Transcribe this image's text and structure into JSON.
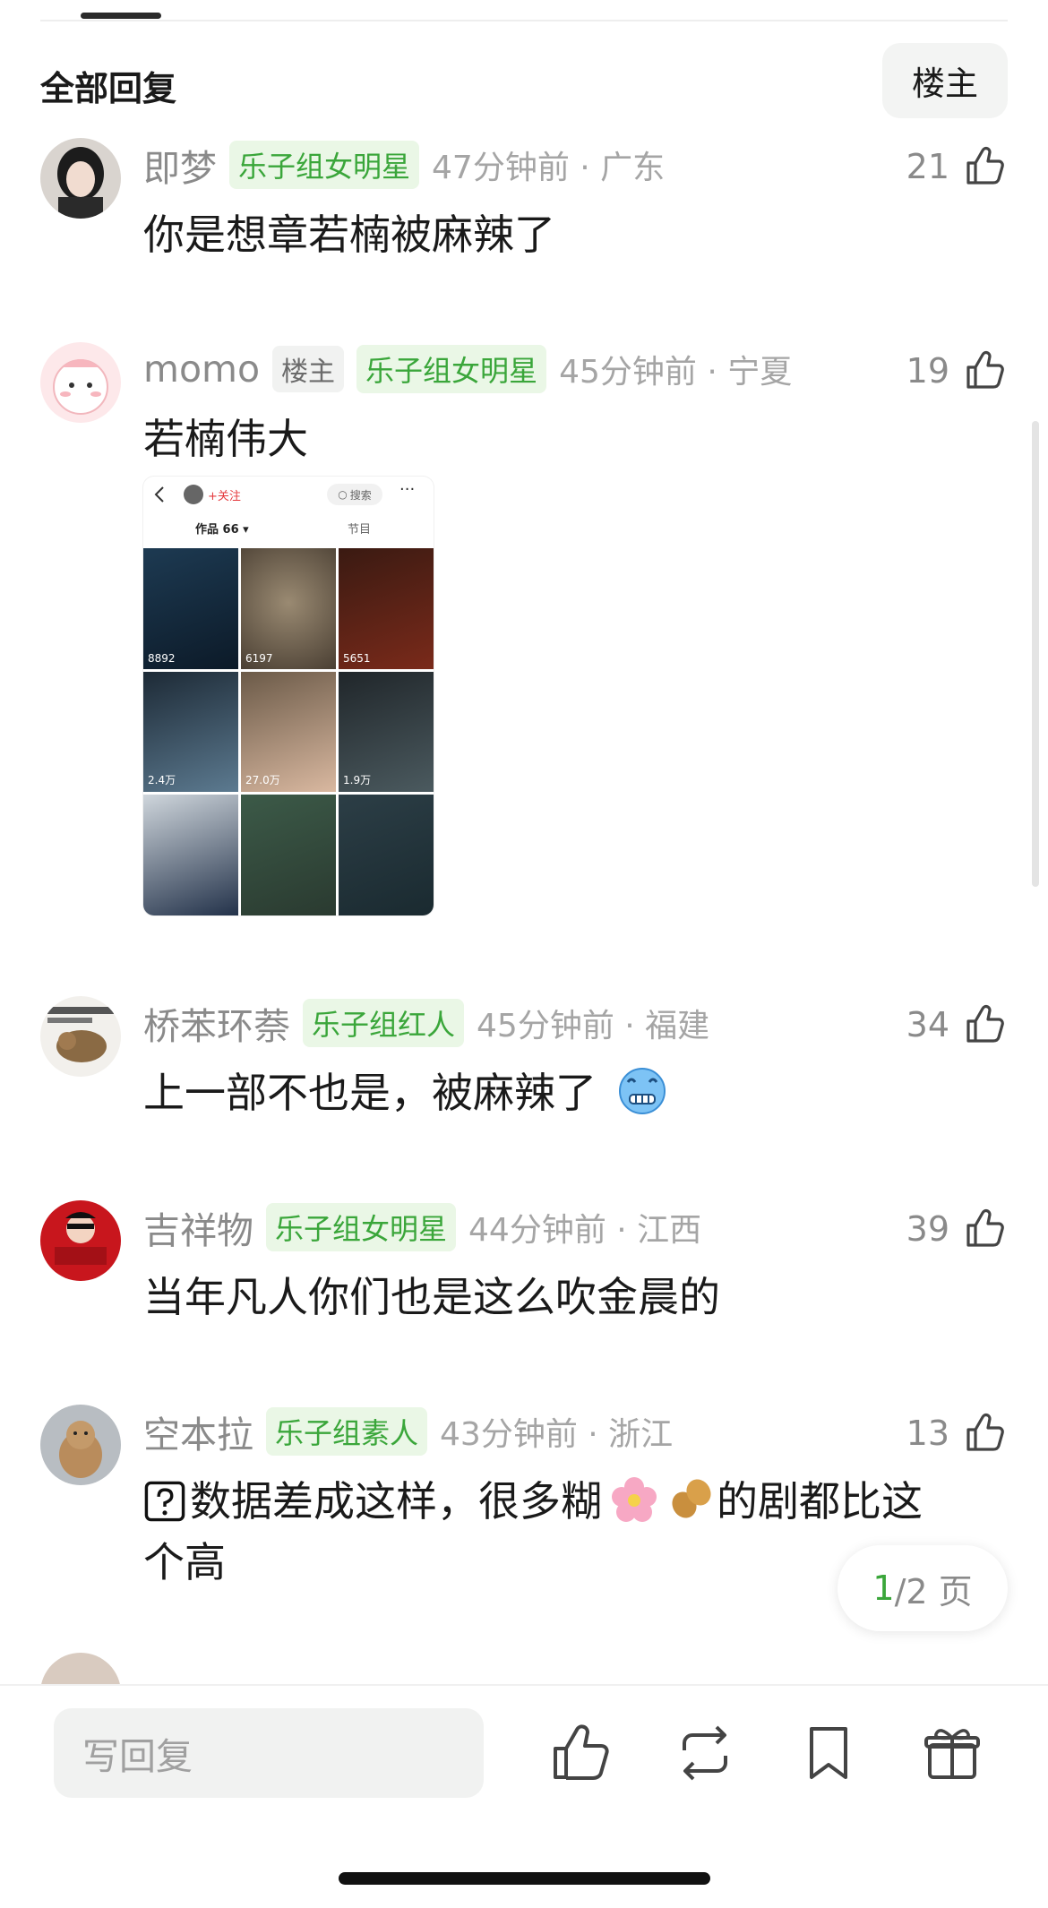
{
  "header": {
    "title": "全部回复",
    "op_button": "楼主"
  },
  "comments": [
    {
      "name": "即梦",
      "badges": [
        "乐子组女明星"
      ],
      "time": "47分钟前 · 广东",
      "likes": "21",
      "text": "你是想章若楠被麻辣了"
    },
    {
      "name": "momo",
      "op_badge": "楼主",
      "badges": [
        "乐子组女明星"
      ],
      "time": "45分钟前 · 宁夏",
      "likes": "19",
      "text": "若楠伟大",
      "image": {
        "follow": "+关注",
        "search": "搜索",
        "tab_works": "作品 66 ▾",
        "tab_show": "节目",
        "tiles": [
          "8892",
          "6197",
          "5651",
          "2.4万",
          "27.0万",
          "1.9万",
          "",
          "",
          ""
        ]
      }
    },
    {
      "name": "桥苯环萘",
      "badges": [
        "乐子组红人"
      ],
      "time": "45分钟前 · 福建",
      "likes": "34",
      "text": "上一部不也是，被麻辣了",
      "emoji": "cold-face-emoji"
    },
    {
      "name": "吉祥物",
      "badges": [
        "乐子组女明星"
      ],
      "time": "44分钟前 · 江西",
      "likes": "39",
      "text": "当年凡人你们也是这么吹金晨的"
    },
    {
      "name": "空本拉",
      "badges": [
        "乐子组素人"
      ],
      "time": "43分钟前 · 浙江",
      "likes": "13",
      "text_part1": "数据差成这样，很多糊",
      "text_part2": "的剧都比这个高",
      "emojis": [
        "question-box-emoji",
        "flower-emoji",
        "peanut-emoji"
      ]
    }
  ],
  "pagination": {
    "current": "1",
    "total": "/2 页"
  },
  "bottom_bar": {
    "reply_placeholder": "写回复"
  },
  "colors": {
    "accent_green": "#3aa63a",
    "badge_bg": "#eaf7e6"
  }
}
